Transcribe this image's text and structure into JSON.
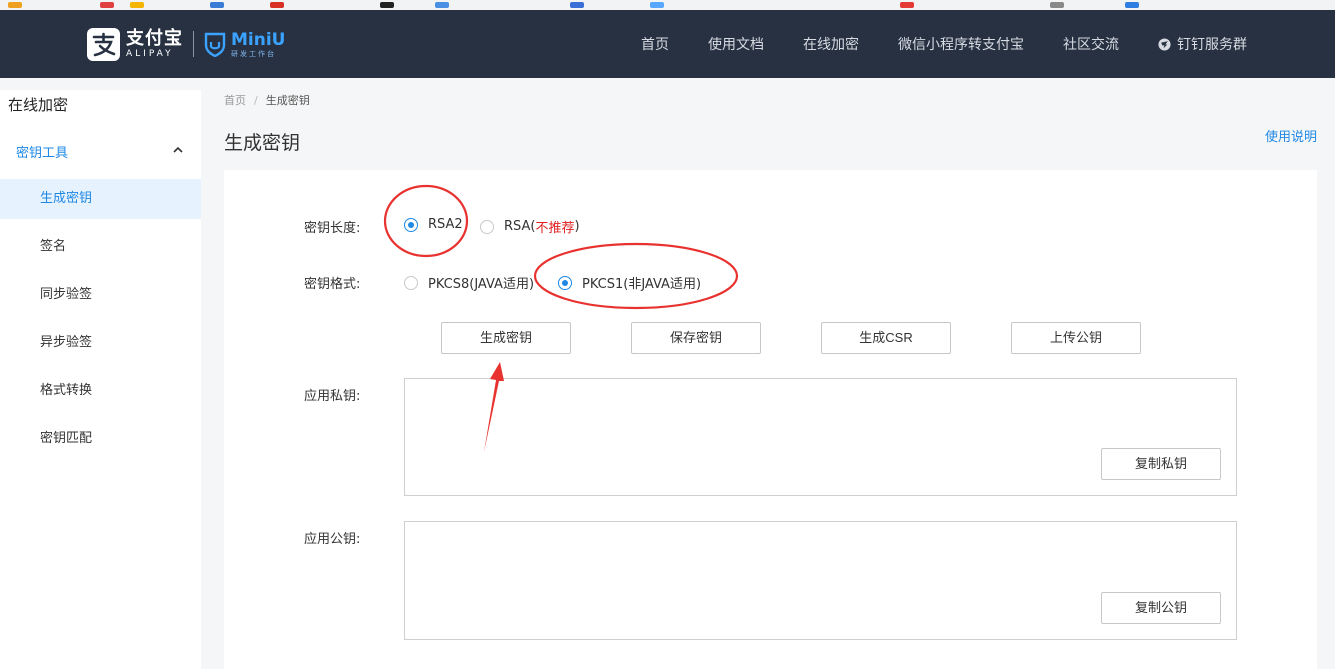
{
  "header": {
    "logo_cn": "支付宝",
    "logo_en": "ALIPAY",
    "miniu_name": "MiniU",
    "miniu_sub": "研发工作台",
    "nav": [
      {
        "label": "首页"
      },
      {
        "label": "使用文档"
      },
      {
        "label": "在线加密"
      },
      {
        "label": "微信小程序转支付宝"
      },
      {
        "label": "社区交流"
      },
      {
        "label": "钉钉服务群",
        "icon": "dingtalk-icon"
      }
    ]
  },
  "sidebar": {
    "title": "在线加密",
    "group_label": "密钥工具",
    "items": [
      {
        "label": "生成密钥",
        "active": true
      },
      {
        "label": "签名"
      },
      {
        "label": "同步验签"
      },
      {
        "label": "异步验签"
      },
      {
        "label": "格式转换"
      },
      {
        "label": "密钥匹配"
      }
    ]
  },
  "breadcrumb": {
    "home": "首页",
    "separator": "/",
    "current": "生成密钥"
  },
  "page": {
    "title": "生成密钥",
    "help_link": "使用说明"
  },
  "form": {
    "key_length": {
      "label": "密钥长度:",
      "options": [
        {
          "label": "RSA2",
          "checked": true
        },
        {
          "label": "RSA(",
          "warn": "不推荐",
          "suffix": ")",
          "checked": false
        }
      ]
    },
    "key_format": {
      "label": "密钥格式:",
      "options": [
        {
          "label": "PKCS8(JAVA适用)",
          "checked": false
        },
        {
          "label": "PKCS1(非JAVA适用)",
          "checked": true
        }
      ]
    },
    "buttons": {
      "generate": "生成密钥",
      "save": "保存密钥",
      "csr": "生成CSR",
      "upload": "上传公钥"
    },
    "private_key": {
      "label": "应用私钥:",
      "value": "",
      "copy_label": "复制私钥"
    },
    "public_key": {
      "label": "应用公钥:",
      "value": "",
      "copy_label": "复制公钥"
    }
  },
  "colors": {
    "navbar": "#273142",
    "accent": "#1e88e5",
    "warn": "#e02020",
    "annotation": "#e8322f"
  }
}
